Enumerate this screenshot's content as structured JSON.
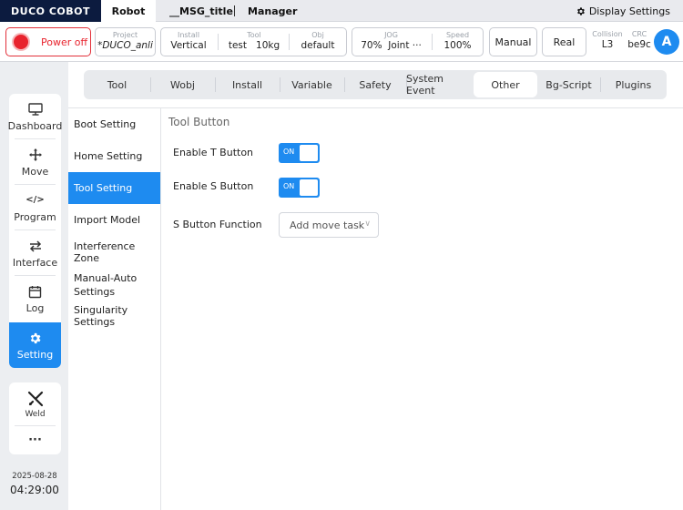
{
  "appbar": {
    "brand": "DUCO COBOT",
    "tabs": [
      {
        "label": "Robot"
      },
      {
        "label": "__MSG_title"
      },
      {
        "label": "Manager"
      }
    ],
    "display_settings": "Display Settings"
  },
  "status": {
    "power": "Power off",
    "project": {
      "label": "Project",
      "value": "*DUCO_anli"
    },
    "install": {
      "label": "Install",
      "value": "Vertical"
    },
    "tool": {
      "label": "Tool",
      "value": "test",
      "value2": "10kg"
    },
    "obj": {
      "label": "Obj",
      "value": "default"
    },
    "jog": {
      "label": "JOG",
      "value": "70%",
      "value2": "Joint ···"
    },
    "speed": {
      "label": "Speed",
      "value": "100%"
    },
    "mode": "Manual",
    "real": "Real",
    "collision": {
      "label": "Collision",
      "value": "L3"
    },
    "crc": {
      "label": "CRC",
      "value": "be9c"
    },
    "avatar": "A"
  },
  "leftnav": {
    "items": [
      {
        "label": "Dashboard",
        "icon": "monitor-icon"
      },
      {
        "label": "Move",
        "icon": "move-arrows-icon"
      },
      {
        "label": "Program",
        "icon": "code-icon"
      },
      {
        "label": "Interface",
        "icon": "swap-icon"
      },
      {
        "label": "Log",
        "icon": "calendar-icon"
      },
      {
        "label": "Setting",
        "icon": "gear-icon"
      }
    ],
    "weld": "Weld",
    "more": "···"
  },
  "datetime": {
    "date": "2025-08-28",
    "time": "04:29:00"
  },
  "settings_tabs": [
    {
      "label": "Tool"
    },
    {
      "label": "Wobj"
    },
    {
      "label": "Install"
    },
    {
      "label": "Variable"
    },
    {
      "label": "Safety"
    },
    {
      "label": "System Event"
    },
    {
      "label": "Other"
    },
    {
      "label": "Bg-Script"
    },
    {
      "label": "Plugins"
    }
  ],
  "subnav": [
    {
      "label": "Boot Setting"
    },
    {
      "label": "Home Setting"
    },
    {
      "label": "Tool Setting"
    },
    {
      "label": "Import Model"
    },
    {
      "label": "Interference Zone"
    },
    {
      "label": "Manual-Auto Settings"
    },
    {
      "label": "Singularity Settings"
    }
  ],
  "content": {
    "title": "Tool Button",
    "enable_t": {
      "label": "Enable T Button",
      "state": "ON"
    },
    "enable_s": {
      "label": "Enable S Button",
      "state": "ON"
    },
    "s_function": {
      "label": "S Button Function",
      "value": "Add move task"
    }
  },
  "colors": {
    "accent": "#1e8bf0",
    "brand_bg": "#0c1b3f",
    "power_red": "#e8232d"
  }
}
